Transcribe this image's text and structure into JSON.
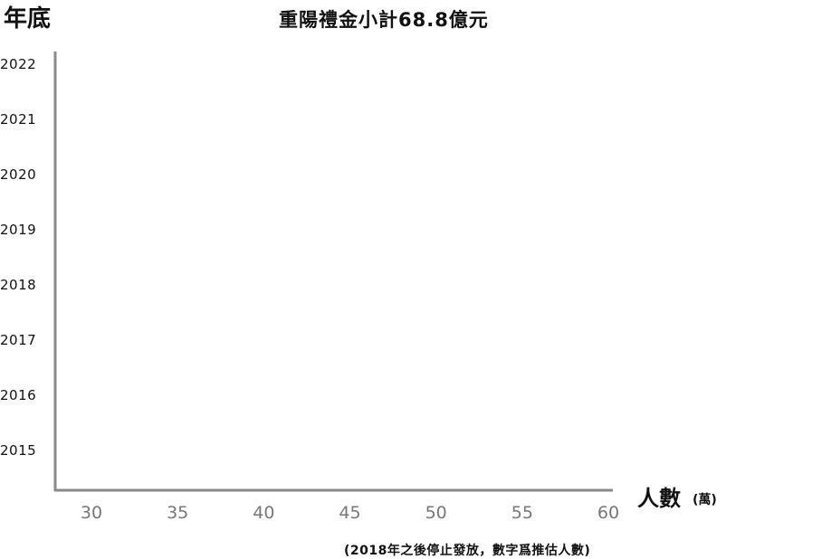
{
  "chart_data": {
    "type": "bar",
    "orientation": "horizontal",
    "title": "重陽禮金小計68.8億元",
    "ylabel": "年底",
    "xlabel": "人數",
    "xunit": "(萬)",
    "footnote": "(2018年之後停止發放，數字爲推估人數)",
    "categories": [
      "2022",
      "2021",
      "2020",
      "2019",
      "2018",
      "2017",
      "2016",
      "2015"
    ],
    "x_ticks": [
      30,
      35,
      40,
      45,
      50,
      55,
      60
    ],
    "xlim": [
      27.5,
      60
    ],
    "grid": false,
    "colors": {
      "axis": "#8a8a8a",
      "tick_text": "#777777",
      "text": "#111111"
    }
  }
}
